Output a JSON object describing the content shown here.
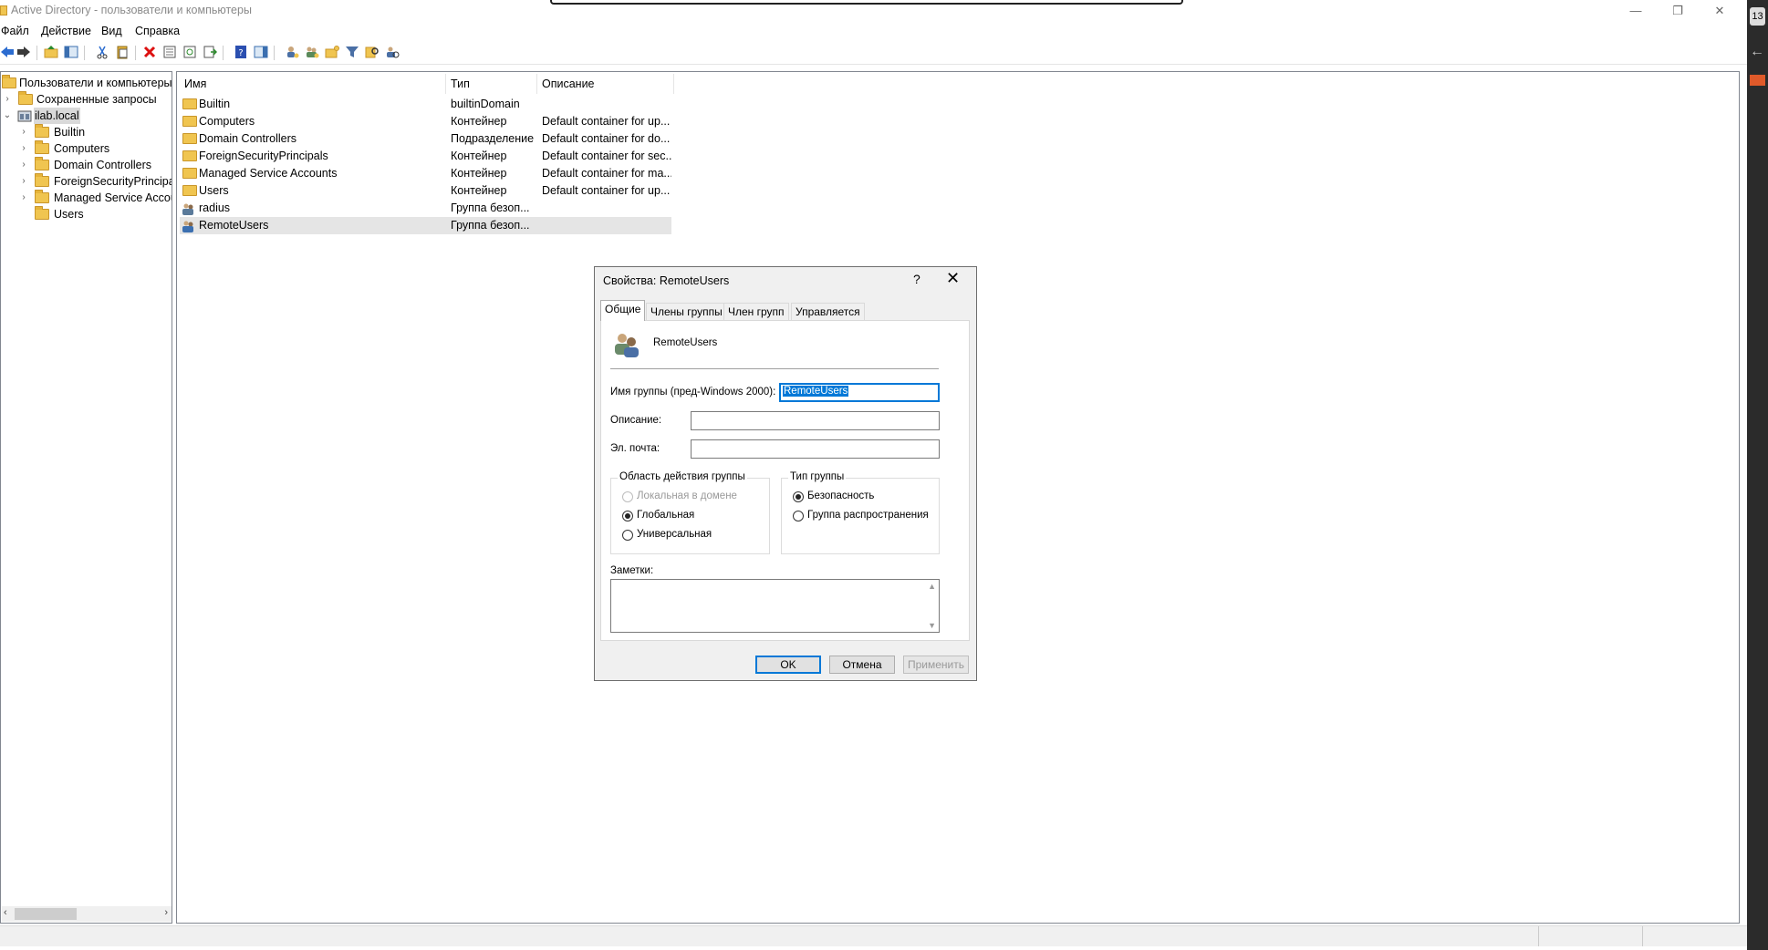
{
  "window": {
    "title": "Active Directory - пользователи и компьютеры",
    "minimize_icon": "minimize-icon",
    "restore_icon": "restore-icon",
    "close_icon": "close-icon"
  },
  "menu": [
    "Файл",
    "Действие",
    "Вид",
    "Справка"
  ],
  "tree": {
    "root": "Пользователи и компьютеры Active Directory",
    "saved_queries": "Сохраненные запросы",
    "domain": "ilab.local",
    "children": [
      "Builtin",
      "Computers",
      "Domain Controllers",
      "ForeignSecurityPrincipals",
      "Managed Service Accounts",
      "Users"
    ]
  },
  "list": {
    "columns": [
      "Имя",
      "Тип",
      "Описание"
    ],
    "rows": [
      {
        "name": "Builtin",
        "type": "builtinDomain",
        "desc": ""
      },
      {
        "name": "Computers",
        "type": "Контейнер",
        "desc": "Default container for up..."
      },
      {
        "name": "Domain Controllers",
        "type": "Подразделение",
        "desc": "Default container for do..."
      },
      {
        "name": "ForeignSecurityPrincipals",
        "type": "Контейнер",
        "desc": "Default container for sec..."
      },
      {
        "name": "Managed Service Accounts",
        "type": "Контейнер",
        "desc": "Default container for ma..."
      },
      {
        "name": "Users",
        "type": "Контейнер",
        "desc": "Default container for up..."
      },
      {
        "name": "radius",
        "type": "Группа безоп...",
        "desc": ""
      },
      {
        "name": "RemoteUsers",
        "type": "Группа безоп...",
        "desc": ""
      }
    ]
  },
  "dialog": {
    "title": "Свойства: RemoteUsers",
    "help": "?",
    "close": "✕",
    "tabs": [
      "Общие",
      "Члены группы",
      "Член групп",
      "Управляется"
    ],
    "group_name": "RemoteUsers",
    "prewin_label": "Имя группы (пред-Windows 2000):",
    "prewin_value": "RemoteUsers",
    "desc_label": "Описание:",
    "desc_value": "",
    "email_label": "Эл. почта:",
    "email_value": "",
    "scope": {
      "legend": "Область действия группы",
      "options": [
        "Локальная в домене",
        "Глобальная",
        "Универсальная"
      ],
      "selected": "Глобальная"
    },
    "type": {
      "legend": "Тип группы",
      "options": [
        "Безопасность",
        "Группа распространения"
      ],
      "selected": "Безопасность"
    },
    "notes_label": "Заметки:",
    "buttons": {
      "ok": "OK",
      "cancel": "Отмена",
      "apply": "Применить"
    }
  },
  "edge_badge": "13"
}
